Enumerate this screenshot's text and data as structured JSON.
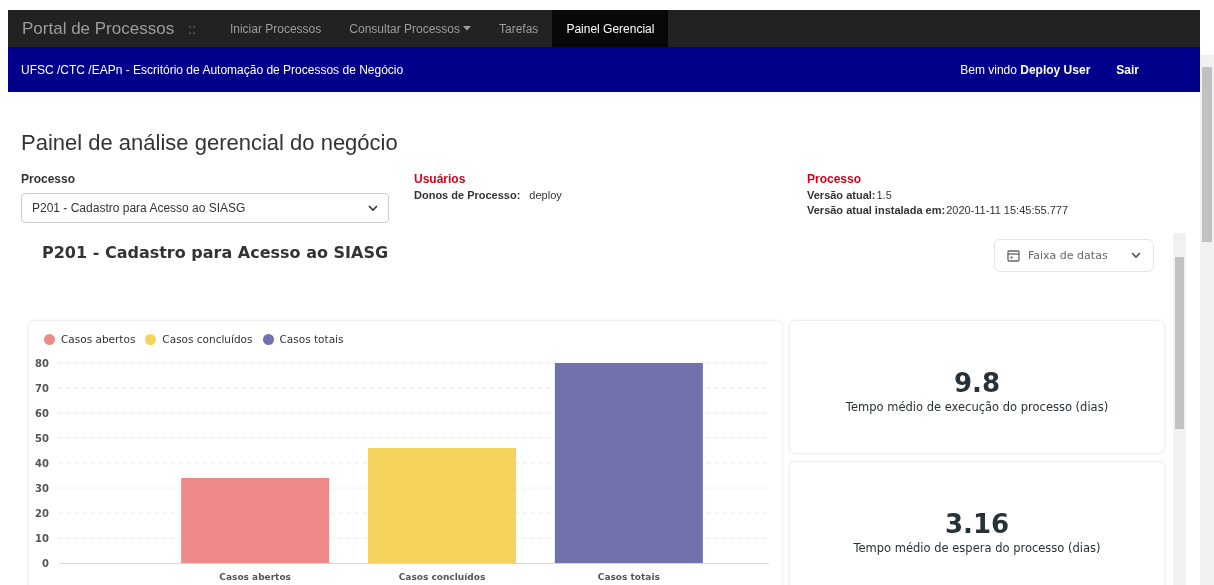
{
  "navbar": {
    "brand": "Portal de Processos",
    "separator": "::",
    "items": [
      {
        "label": "Iniciar Processos",
        "dropdown": false,
        "selected": false
      },
      {
        "label": "Consultar Processos",
        "dropdown": true,
        "selected": false
      },
      {
        "label": "Tarefas",
        "dropdown": false,
        "selected": false
      },
      {
        "label": "Painel Gerencial",
        "dropdown": false,
        "selected": true
      }
    ]
  },
  "subheader": {
    "org": "UFSC /CTC /EAPn - Escritório de Automação de Processos de Negócio",
    "welcome": "Bem vindo **Deploy User**",
    "logout": "Sair"
  },
  "page_title": "Painel de análise gerencial do negócio",
  "process_select": {
    "label": "Processo",
    "value": "P201 - Cadastro para Acesso ao SIASG"
  },
  "users": {
    "heading": "Usuários",
    "owners_label": "Donos de Processo:",
    "owners_value": "deploy"
  },
  "process_info": {
    "heading": "Processo",
    "version_label": "Versão atual:",
    "version_value": "1.5",
    "installed_label": "Versão atual instalada em:",
    "installed_value": "2020-11-11 15:45:55.777"
  },
  "dashboard": {
    "title": "P201 - Cadastro para Acesso ao SIASG",
    "date_range": "Faixa de datas",
    "chart": {
      "chart_data": {
        "type": "bar",
        "categories": [
          "Casos abertos",
          "Casos concluídos",
          "Casos totais"
        ],
        "series": [
          {
            "name": "Casos abertos",
            "color": "#ef8a8a",
            "values": [
              34,
              null,
              null
            ]
          },
          {
            "name": "Casos concluídos",
            "color": "#f6d35c",
            "values": [
              null,
              46,
              null
            ]
          },
          {
            "name": "Casos totais",
            "color": "#7171ad",
            "values": [
              null,
              null,
              80
            ]
          }
        ],
        "grid": true,
        "ylim": [
          0,
          80
        ],
        "yticks": [
          0,
          10,
          20,
          30,
          40,
          50,
          60,
          70,
          80
        ]
      }
    },
    "kpis": [
      {
        "value": "9.8",
        "label": "Tempo médio de execução do processo (dias)"
      },
      {
        "value": "3.16",
        "label": "Tempo médio de espera do processo (dias)"
      }
    ]
  }
}
